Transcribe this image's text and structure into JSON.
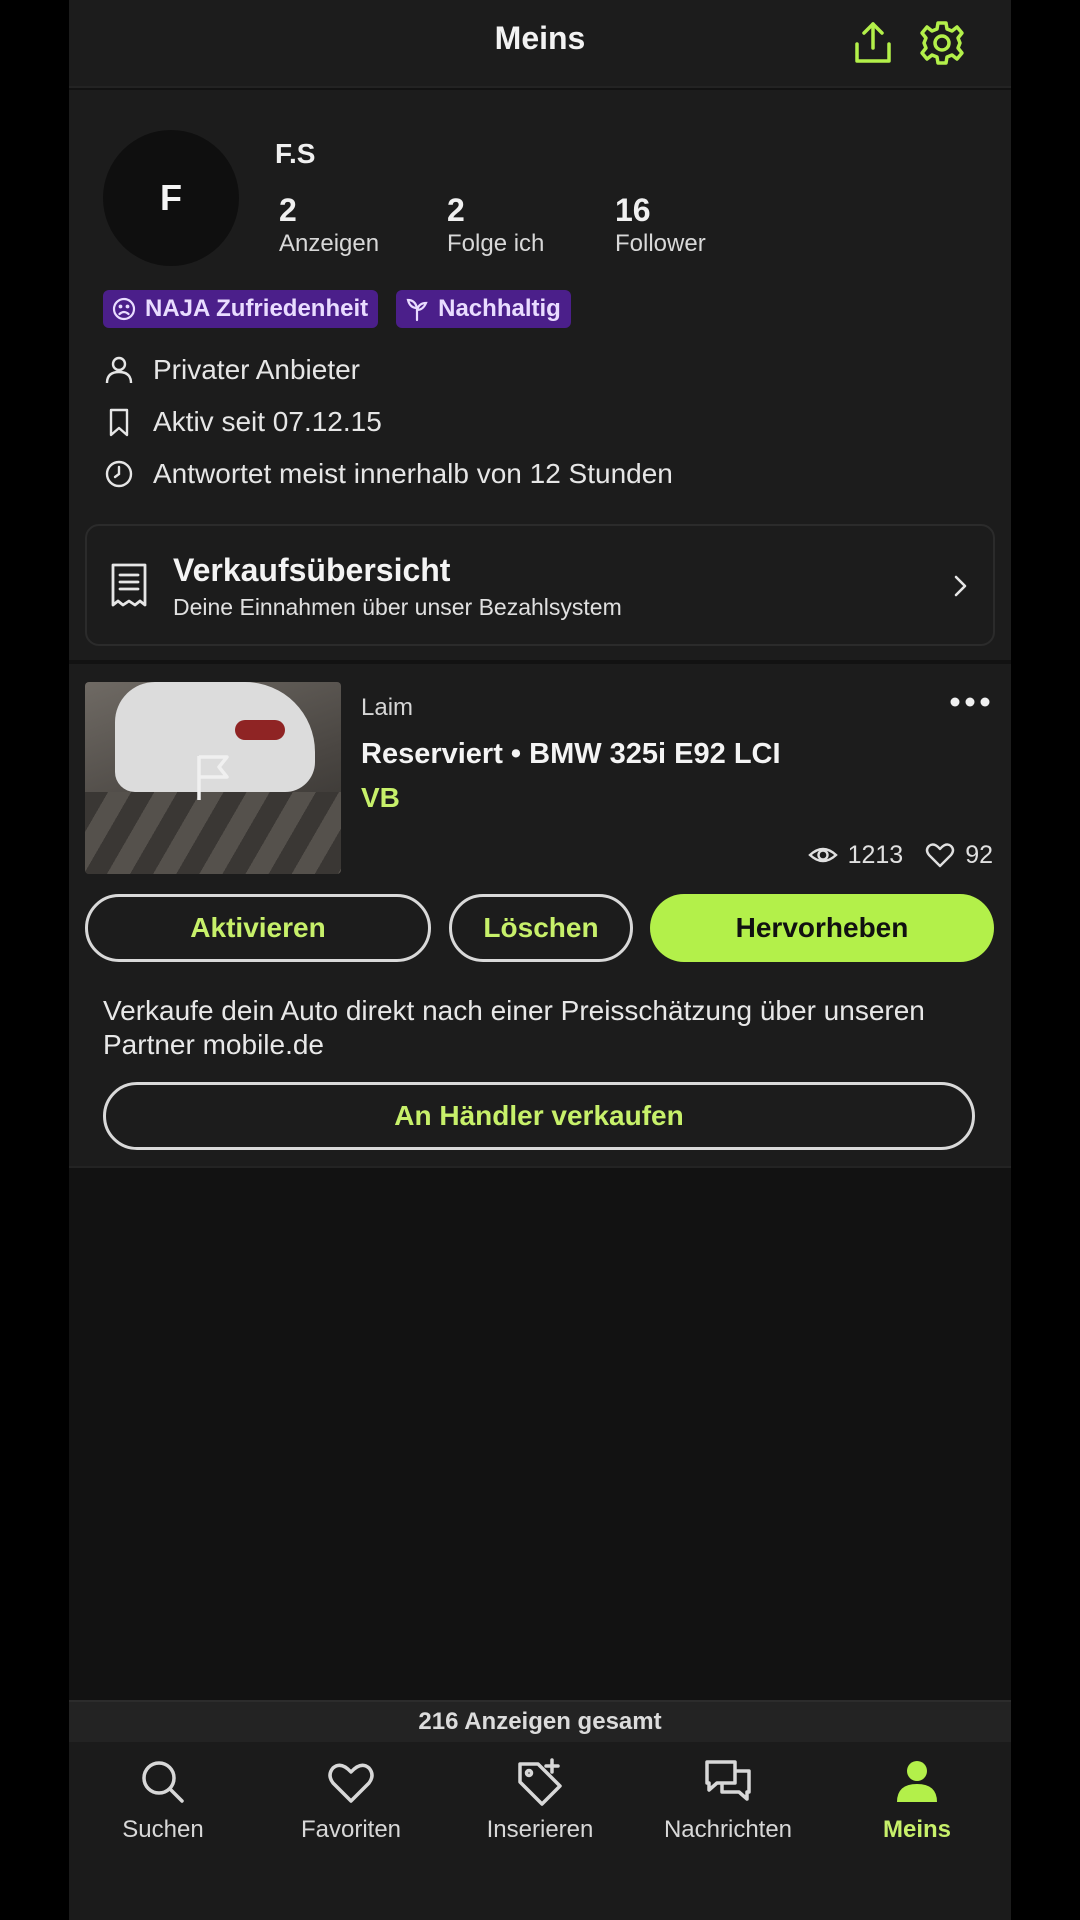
{
  "header": {
    "title": "Meins"
  },
  "profile": {
    "avatar_initial": "F",
    "username": "F.S",
    "stats": [
      {
        "value": "2",
        "label": "Anzeigen"
      },
      {
        "value": "2",
        "label": "Folge ich"
      },
      {
        "value": "16",
        "label": "Follower"
      }
    ],
    "badges": [
      {
        "label": "NAJA Zufriedenheit",
        "icon": "sad-face-icon"
      },
      {
        "label": "Nachhaltig",
        "icon": "sprout-icon"
      }
    ],
    "info": [
      {
        "icon": "person-icon",
        "text": "Privater Anbieter"
      },
      {
        "icon": "bookmark-icon",
        "text": "Aktiv seit 07.12.15"
      },
      {
        "icon": "clock-icon",
        "text": "Antwortet meist innerhalb von 12 Stunden"
      }
    ]
  },
  "sales_overview": {
    "title": "Verkaufsübersicht",
    "subtitle": "Deine Einnahmen über unser Bezahlsystem"
  },
  "listing": {
    "location": "Laim",
    "title": "Reserviert • BMW 325i E92 LCI",
    "price": "VB",
    "views": "1213",
    "likes": "92",
    "buttons": {
      "activate": "Aktivieren",
      "delete": "Löschen",
      "highlight": "Hervorheben"
    },
    "promo_text": "Verkaufe dein Auto direkt nach einer Preisschätzung über unseren Partner mobile.de",
    "dealer_button": "An Händler verkaufen"
  },
  "total_ads": "216 Anzeigen gesamt",
  "tabbar": [
    {
      "label": "Suchen",
      "icon": "search-icon",
      "active": false
    },
    {
      "label": "Favoriten",
      "icon": "heart-icon",
      "active": false
    },
    {
      "label": "Inserieren",
      "icon": "tag-plus-icon",
      "active": false
    },
    {
      "label": "Nachrichten",
      "icon": "chat-icon",
      "active": false
    },
    {
      "label": "Meins",
      "icon": "person-filled-icon",
      "active": true
    }
  ],
  "colors": {
    "accent": "#b3f04a",
    "accent_text": "#c7f06a",
    "badge_bg": "#4b1f8a",
    "surface": "#1c1c1c",
    "background": "#121212"
  }
}
